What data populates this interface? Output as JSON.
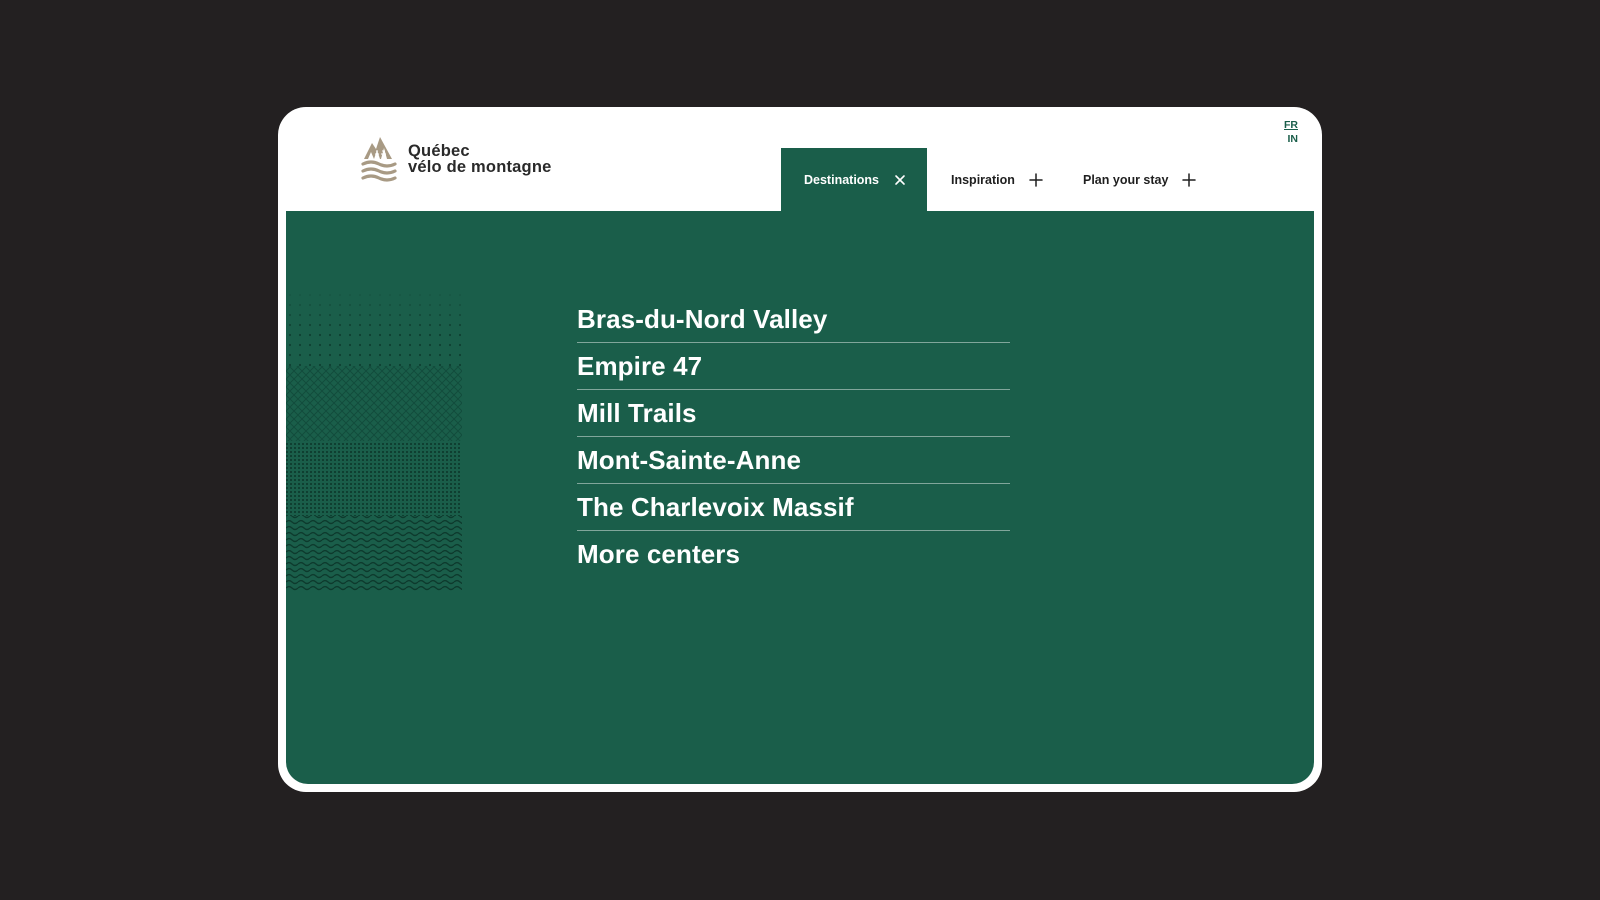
{
  "brand": {
    "line1": "Québec",
    "line2": "vélo de montagne"
  },
  "language": {
    "fr": "FR",
    "in": "IN"
  },
  "nav": {
    "destinations": "Destinations",
    "inspiration": "Inspiration",
    "plan": "Plan your stay"
  },
  "destinations": [
    "Bras-du-Nord Valley",
    "Empire 47",
    "Mill Trails",
    "Mont-Sainte-Anne",
    "The Charlevoix Massif",
    "More centers"
  ],
  "colors": {
    "brand_green": "#1a5e4a",
    "background": "#232021",
    "logo_tan": "#a89a84"
  },
  "icons": [
    "logo-mountain-icon",
    "close-icon",
    "plus-icon"
  ]
}
